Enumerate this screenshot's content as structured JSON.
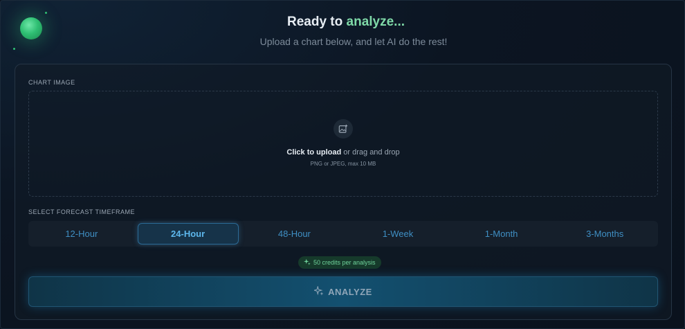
{
  "header": {
    "title_prefix": "Ready to",
    "title_accent": "analyze...",
    "subtitle": "Upload a chart below, and let AI do the rest!"
  },
  "upload": {
    "section_label": "CHART IMAGE",
    "click_text": "Click to upload",
    "drag_text": "or drag and drop",
    "hint": "PNG or JPEG, max 10 MB",
    "icon": "image-add-icon"
  },
  "forecast": {
    "section_label": "SELECT FORECAST TIMEFRAME",
    "options": [
      "12-Hour",
      "24-Hour",
      "48-Hour",
      "1-Week",
      "1-Month",
      "3-Months"
    ],
    "selected": "24-Hour"
  },
  "credits": {
    "label": "50 credits per analysis",
    "icon": "sparkles-icon"
  },
  "analyze_button": {
    "label": "ANALYZE",
    "icon": "sparkles-icon"
  },
  "colors": {
    "accent_green": "#7fd9a8",
    "accent_blue": "#5db7ec",
    "background": "#0b1420"
  }
}
